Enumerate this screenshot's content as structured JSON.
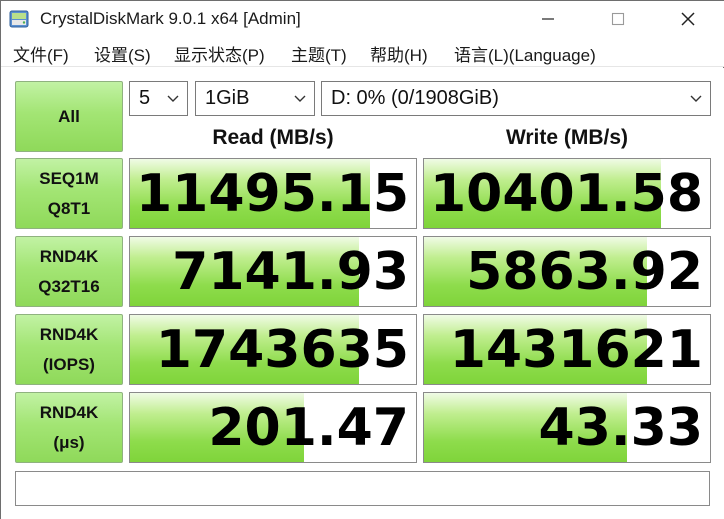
{
  "window": {
    "title": "CrystalDiskMark 9.0.1 x64 [Admin]"
  },
  "menu": {
    "items": [
      {
        "label": "文件(F)"
      },
      {
        "label": "设置(S)"
      },
      {
        "label": "显示状态(P)"
      },
      {
        "label": "主题(T)"
      },
      {
        "label": "帮助(H)"
      },
      {
        "label": "语言(L)(Language)"
      }
    ]
  },
  "controls": {
    "all_label": "All",
    "count_value": "5",
    "size_value": "1GiB",
    "drive_value": "D: 0% (0/1908GiB)"
  },
  "headers": {
    "read": "Read (MB/s)",
    "write": "Write (MB/s)"
  },
  "tests": [
    {
      "line1": "SEQ1M",
      "line2": "Q8T1",
      "read": "11495.15",
      "write": "10401.58",
      "read_fill": 0.84,
      "write_fill": 0.83
    },
    {
      "line1": "RND4K",
      "line2": "Q32T16",
      "read": "7141.93",
      "write": "5863.92",
      "read_fill": 0.8,
      "write_fill": 0.78
    },
    {
      "line1": "RND4K",
      "line2": "(IOPS)",
      "read": "1743635",
      "write": "1431621",
      "read_fill": 0.8,
      "write_fill": 0.78
    },
    {
      "line1": "RND4K",
      "line2": "(μs)",
      "read": "201.47",
      "write": "43.33",
      "read_fill": 0.61,
      "write_fill": 0.71
    }
  ],
  "status": {
    "text": ""
  },
  "colors": {
    "bar_green": "#8edc4c",
    "button_green": "#a3e574"
  },
  "icons": {
    "app": "crystaldiskmark-icon",
    "minimize": "minimize-icon",
    "maximize": "maximize-icon",
    "close": "close-icon",
    "dropdown": "chevron-down-icon"
  }
}
